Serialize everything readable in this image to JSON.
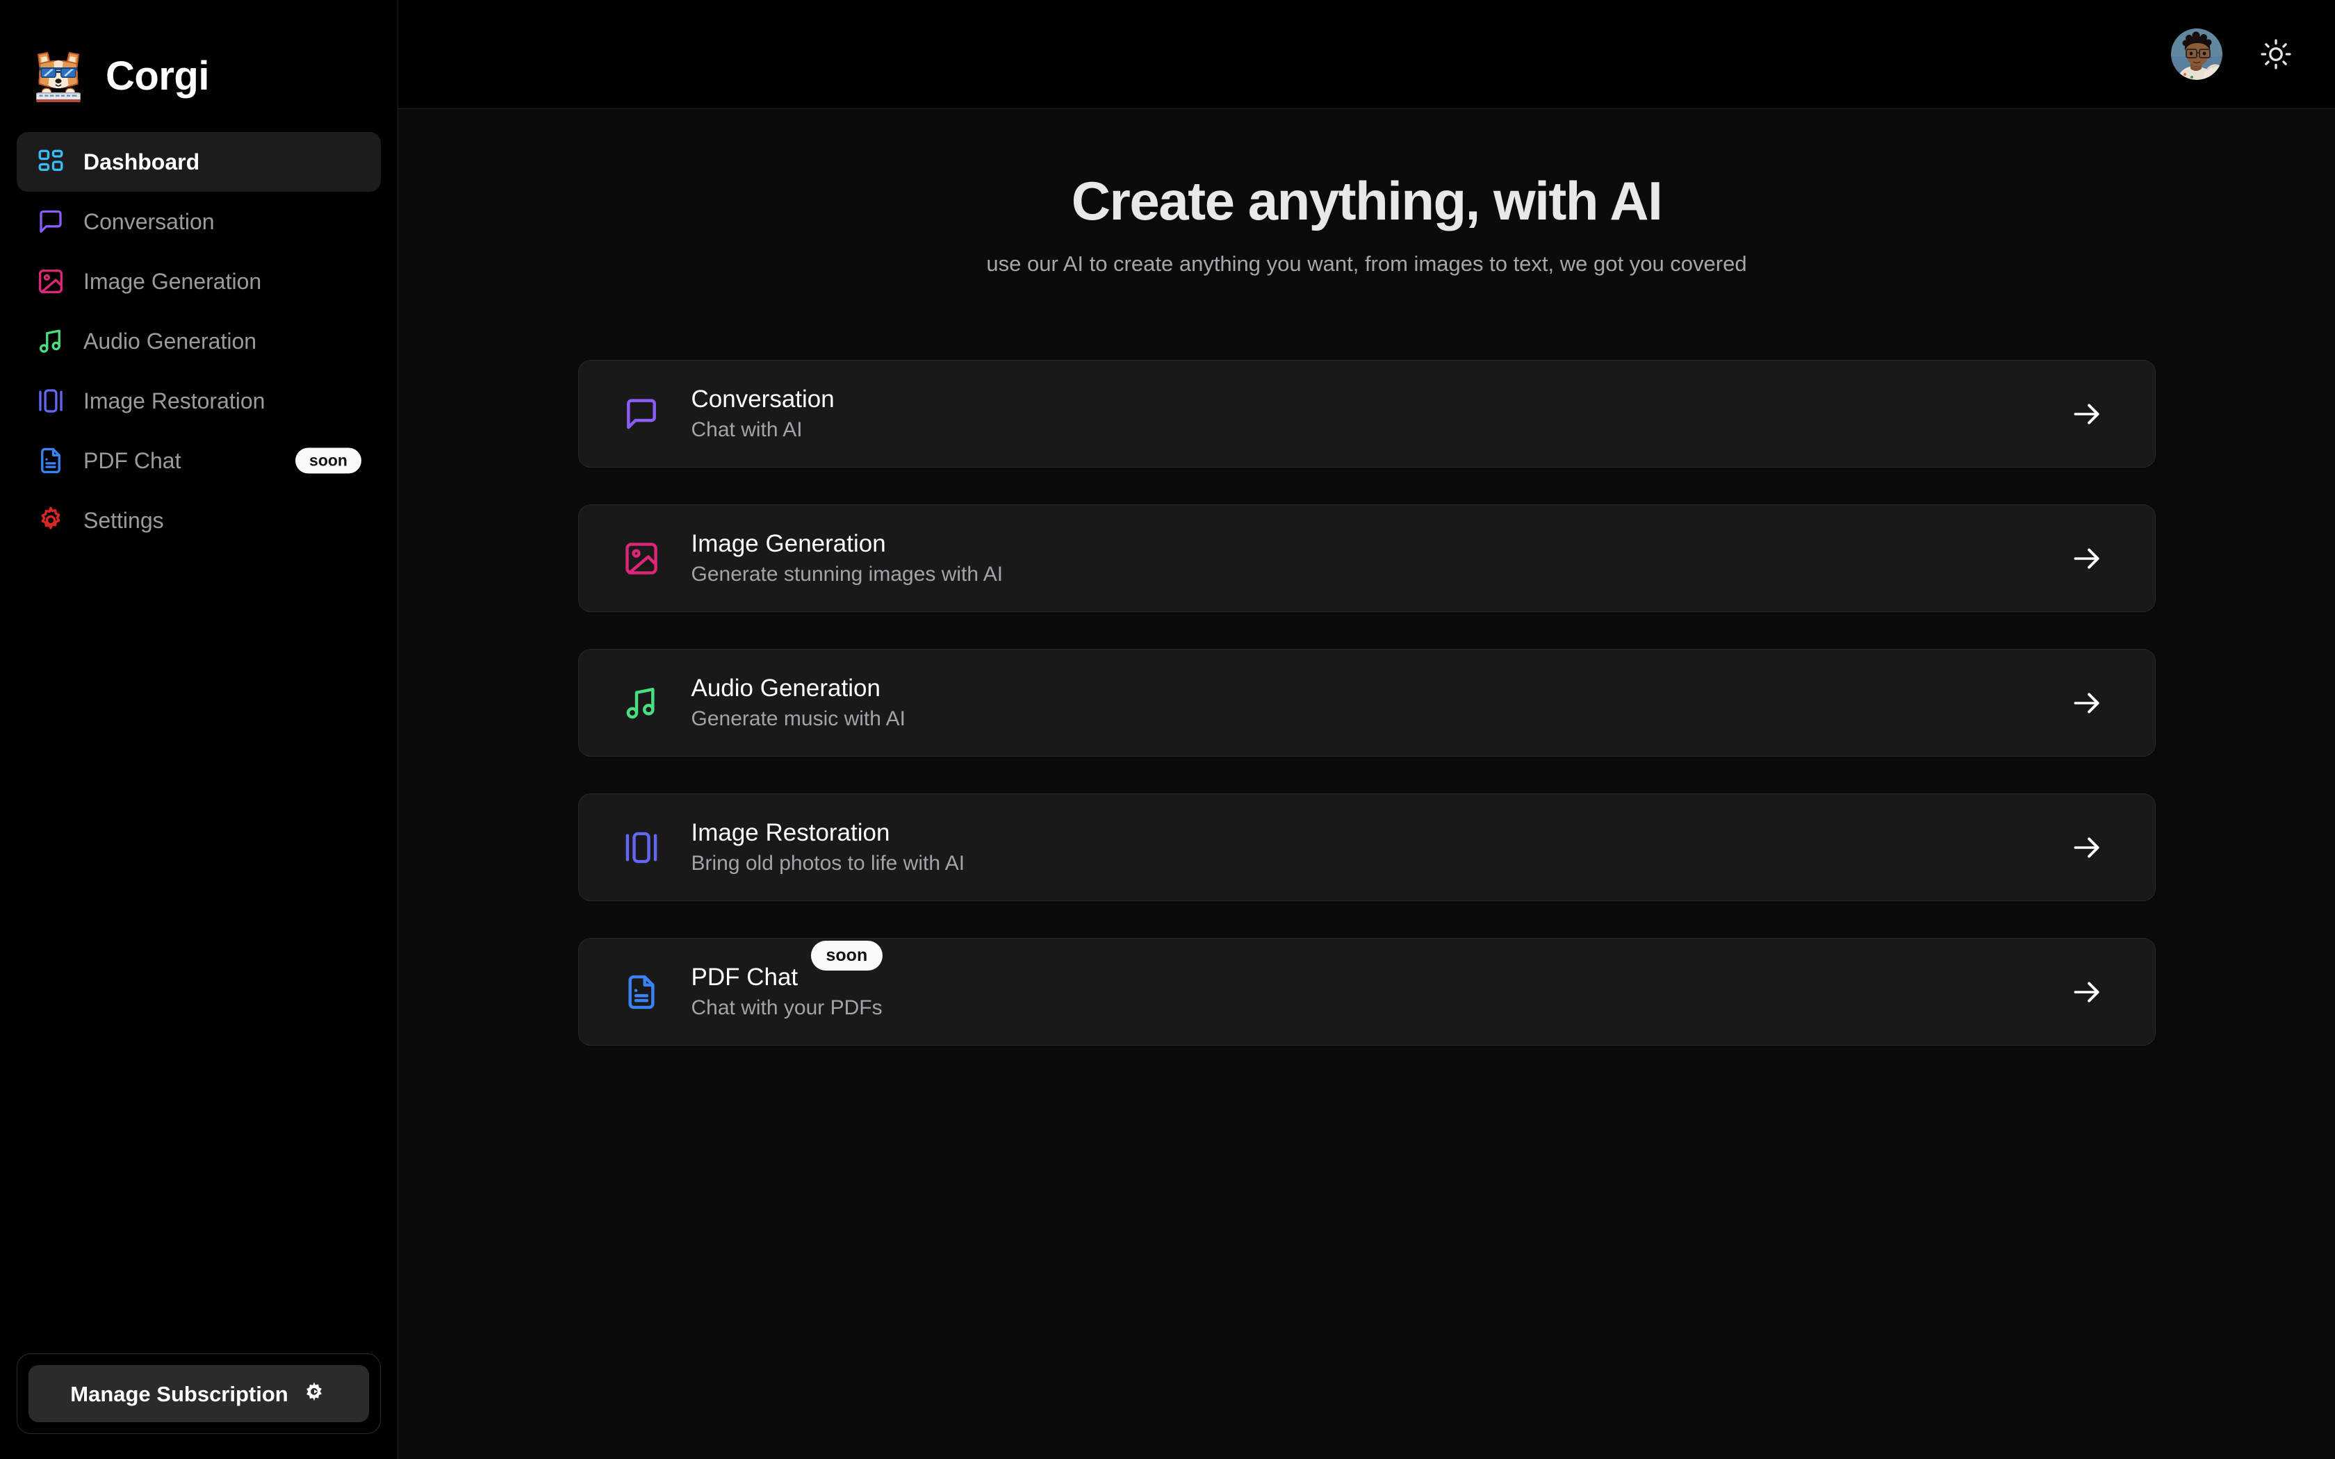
{
  "brand": {
    "name": "Corgi",
    "logo_icon": "corgi-pixel-logo"
  },
  "sidebar": {
    "items": [
      {
        "label": "Dashboard",
        "icon": "grid-icon",
        "color": "#38bdf8",
        "active": true,
        "badge": ""
      },
      {
        "label": "Conversation",
        "icon": "chat-bubble-icon",
        "color": "#8b5cf6",
        "active": false,
        "badge": ""
      },
      {
        "label": "Image Generation",
        "icon": "image-icon",
        "color": "#db2777",
        "active": false,
        "badge": ""
      },
      {
        "label": "Audio Generation",
        "icon": "music-note-icon",
        "color": "#4ade80",
        "active": false,
        "badge": ""
      },
      {
        "label": "Image Restoration",
        "icon": "restore-icon",
        "color": "#6366f1",
        "active": false,
        "badge": ""
      },
      {
        "label": "PDF Chat",
        "icon": "document-icon",
        "color": "#3b82f6",
        "active": false,
        "badge": "soon"
      },
      {
        "label": "Settings",
        "icon": "gear-icon",
        "color": "#dc2626",
        "active": false,
        "badge": ""
      }
    ],
    "subscription": {
      "label": "Manage Subscription",
      "icon": "gear-icon"
    }
  },
  "topbar": {
    "avatar_icon": "user-avatar",
    "theme_toggle_icon": "sun-icon"
  },
  "main": {
    "title": "Create anything, with AI",
    "subtitle": "use our AI to create anything you want, from images to text, we got you covered",
    "cards": [
      {
        "title": "Conversation",
        "desc": "Chat with AI",
        "icon": "chat-bubble-icon",
        "color": "#8b5cf6",
        "badge": "",
        "arrow": "arrow-right-icon"
      },
      {
        "title": "Image Generation",
        "desc": "Generate stunning images with AI",
        "icon": "image-icon",
        "color": "#db2777",
        "badge": "",
        "arrow": "arrow-right-icon"
      },
      {
        "title": "Audio Generation",
        "desc": "Generate music with AI",
        "icon": "music-note-icon",
        "color": "#4ade80",
        "badge": "",
        "arrow": "arrow-right-icon"
      },
      {
        "title": "Image Restoration",
        "desc": "Bring old photos to life with AI",
        "icon": "restore-icon",
        "color": "#6366f1",
        "badge": "",
        "arrow": "arrow-right-icon"
      },
      {
        "title": "PDF Chat",
        "desc": "Chat with your PDFs",
        "icon": "document-icon",
        "color": "#3b82f6",
        "badge": "soon",
        "arrow": "arrow-right-icon"
      }
    ]
  },
  "colors": {
    "page_bg": "#0a0a0b",
    "sidebar_bg": "#000000",
    "card_bg": "#191919",
    "accent_active": "#1c1c1f",
    "badge_bg": "#fafafa"
  }
}
